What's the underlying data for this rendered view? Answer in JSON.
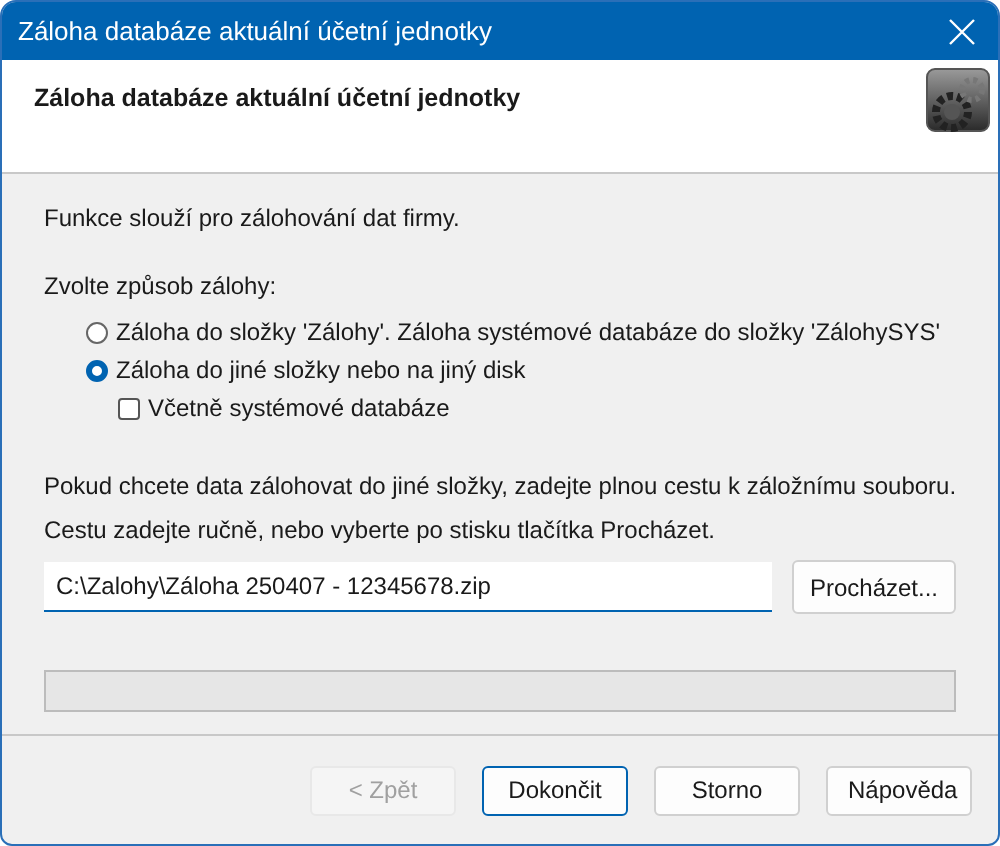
{
  "window": {
    "title": "Záloha databáze aktuální účetní jednotky"
  },
  "header": {
    "title": "Záloha databáze aktuální účetní jednotky"
  },
  "description": "Funkce slouží pro zálohování dat firmy.",
  "mode_label": "Zvolte způsob zálohy:",
  "options": [
    {
      "label": "Záloha do složky 'Zálohy'. Záloha systémové databáze do složky 'ZálohySYS'",
      "selected": false
    },
    {
      "label": "Záloha do jiné složky nebo na jiný disk",
      "selected": true
    }
  ],
  "include_system": {
    "label": "Včetně systémové databáze",
    "checked": false
  },
  "path_hint_1": "Pokud chcete data zálohovat do jiné složky, zadejte plnou cestu k záložnímu souboru.",
  "path_hint_2": "Cestu zadejte ručně, nebo vyberte po stisku tlačítka Procházet.",
  "path": {
    "value": "C:\\Zalohy\\Záloha 250407 - 12345678.zip"
  },
  "browse_button": "Procházet...",
  "progress": {
    "level": 0
  },
  "buttons": [
    {
      "label": "< Zpět",
      "disabled": true,
      "default": false
    },
    {
      "label": "Dokončit",
      "disabled": false,
      "default": true
    },
    {
      "label": "Storno",
      "disabled": false,
      "default": false
    },
    {
      "label": "Nápověda",
      "disabled": false,
      "default": false
    }
  ]
}
